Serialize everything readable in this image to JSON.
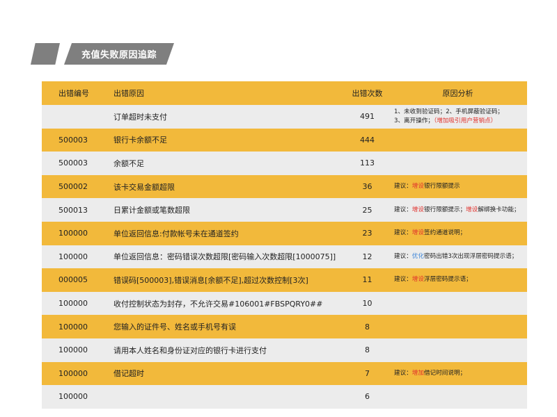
{
  "page": {
    "title": "充值失败原因追踪"
  },
  "colors": {
    "accent": "#f2b93b",
    "row_alt": "#ececec",
    "tab": "#7f7f7f",
    "highlight_red": "#e0302b",
    "highlight_blue": "#3f86d8"
  },
  "table": {
    "headers": {
      "code": "出错编号",
      "reason": "出错原因",
      "count": "出错次数",
      "analysis": "原因分析"
    },
    "rows": [
      {
        "code": "",
        "reason": "订单超时未支付",
        "count": "491",
        "analysis_line1": "1、未收到验证码；2、手机屏蔽验证码；",
        "analysis_line2a": "3、离开操作；",
        "analysis_line2b": "（增加吸引用户营销点）"
      },
      {
        "code": "500003",
        "reason": "银行卡余额不足",
        "count": "444"
      },
      {
        "code": "500003",
        "reason": "余额不足",
        "count": "113"
      },
      {
        "code": "500002",
        "reason": "该卡交易金额超限",
        "count": "36",
        "a1": "建议：",
        "a2": "增设",
        "a3": "银行限额提示"
      },
      {
        "code": "500013",
        "reason": "日累计金额或笔数超限",
        "count": "25",
        "a1": "建议：",
        "a2": "增设",
        "a3": "银行限额提示；",
        "a4": "增设",
        "a5": "解绑换卡功能；"
      },
      {
        "code": "100000",
        "reason": "单位返回信息:付款帐号未在通道签约",
        "count": "23",
        "a1": "建议：",
        "a2": "增设",
        "a3": "签约通道说明；"
      },
      {
        "code": "100000",
        "reason": "单位返回信息：密码错误次数超限[密码输入次数超限[1000075]]",
        "count": "12",
        "a1": "建议：",
        "a2": "优化",
        "a3": "密码出错3次出现浮层密码提示语；"
      },
      {
        "code": "000005",
        "reason": "错误码[500003],错误消息[余额不足],超过次数控制[3次]",
        "count": "11",
        "a1": "建议：",
        "a2": "增设",
        "a3": "浮层密码提示语；"
      },
      {
        "code": "100000",
        "reason": "收付控制状态为封存，不允许交易#106001#FBSPQRY0##",
        "count": "10"
      },
      {
        "code": "100000",
        "reason": "您输入的证件号、姓名或手机号有误",
        "count": "8"
      },
      {
        "code": "100000",
        "reason": "请用本人姓名和身份证对应的银行卡进行支付",
        "count": "8"
      },
      {
        "code": "100000",
        "reason": "借记超时",
        "count": "7",
        "a1": "建议：",
        "a2": "增加",
        "a3": "借记时间说明；"
      },
      {
        "code": "100000",
        "reason": "",
        "count": "6"
      }
    ]
  }
}
